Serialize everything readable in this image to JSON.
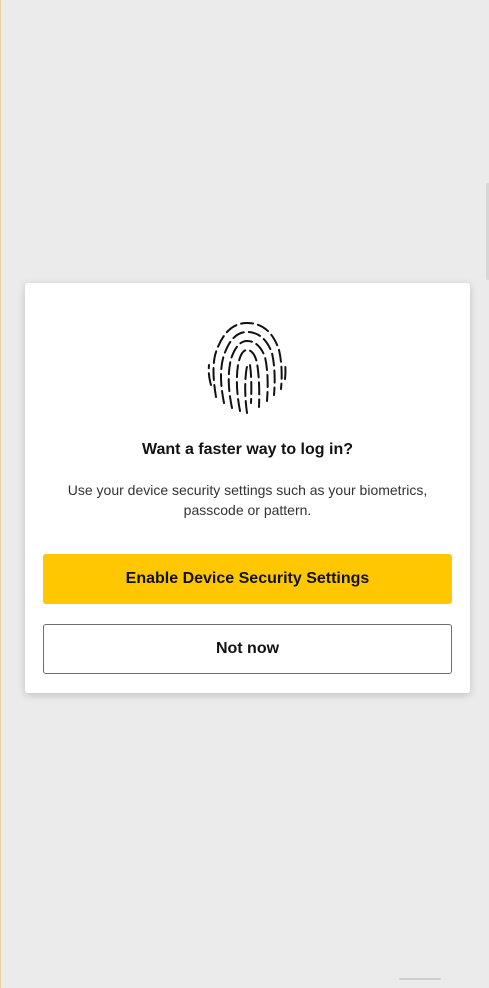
{
  "dialog": {
    "icon": "fingerprint-icon",
    "title": "Want a faster way to log in?",
    "description": "Use your device security settings such as your biometrics, passcode or pattern.",
    "primary_button_label": "Enable Device Security Settings",
    "secondary_button_label": "Not now"
  },
  "colors": {
    "background": "#ebebeb",
    "dialog_background": "#ffffff",
    "primary_button": "#ffc700",
    "primary_text": "#121212",
    "secondary_text": "#333333",
    "secondary_button_border": "#6e6e6e"
  }
}
